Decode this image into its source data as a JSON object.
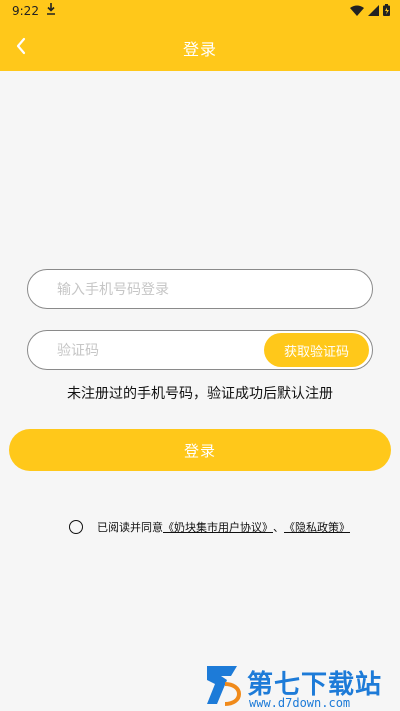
{
  "status_bar": {
    "time": "9:22"
  },
  "header": {
    "title": "登录"
  },
  "form": {
    "phone_placeholder": "输入手机号码登录",
    "code_placeholder": "验证码",
    "get_code_label": "获取验证码",
    "hint": "未注册过的手机号码，验证成功后默认注册",
    "login_label": "登录"
  },
  "agreement": {
    "prefix": "已阅读并同意",
    "link1": "《奶块集市用户协议》",
    "separator": "、",
    "link2": "《隐私政策》"
  },
  "watermark": {
    "text": "第七下载站",
    "url": "www.d7down.com"
  },
  "colors": {
    "accent": "#ffc81a",
    "watermark": "#1d7bd8"
  }
}
